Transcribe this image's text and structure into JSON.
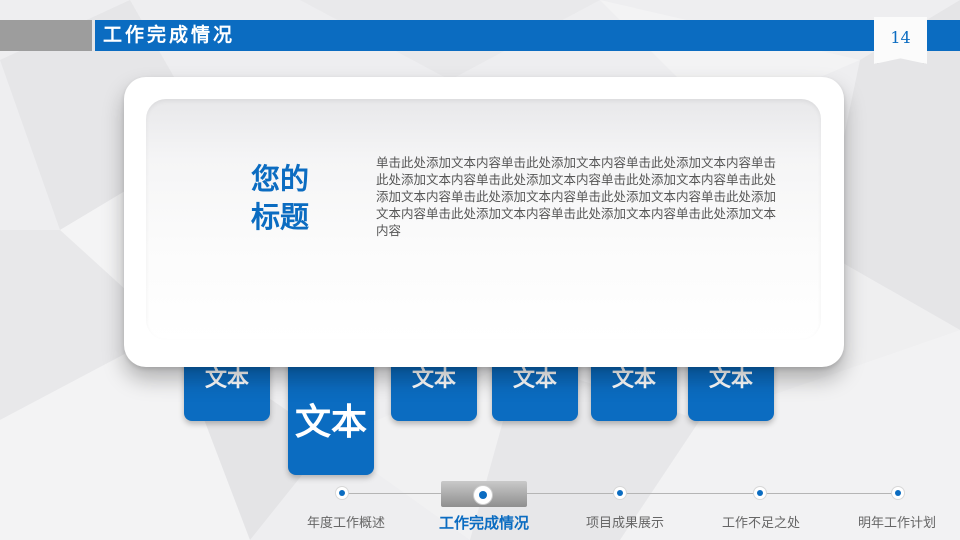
{
  "header": {
    "title": "工作完成情况",
    "page_number": "14"
  },
  "card": {
    "title": "您的标题",
    "body": "单击此处添加文本内容单击此处添加文本内容单击此处添加文本内容单击此处添加文本内容单击此处添加文本内容单击此处添加文本内容单击此处添加文本内容单击此处添加文本内容单击此处添加文本内容单击此处添加文本内容单击此处添加文本内容单击此处添加文本内容单击此处添加文本内容"
  },
  "tabs": [
    {
      "label": "文本"
    },
    {
      "label": "文本",
      "active": true
    },
    {
      "label": "文本"
    },
    {
      "label": "文本"
    },
    {
      "label": "文本"
    },
    {
      "label": "文本"
    }
  ],
  "nav": {
    "items": [
      {
        "label": "年度工作概述"
      },
      {
        "label": "工作完成情况",
        "active": true
      },
      {
        "label": "项目成果展示"
      },
      {
        "label": "工作不足之处"
      },
      {
        "label": "明年工作计划"
      }
    ]
  },
  "colors": {
    "accent": "#0b6cc1",
    "header_gray": "#9d9d9d",
    "background": "#efeff1"
  }
}
